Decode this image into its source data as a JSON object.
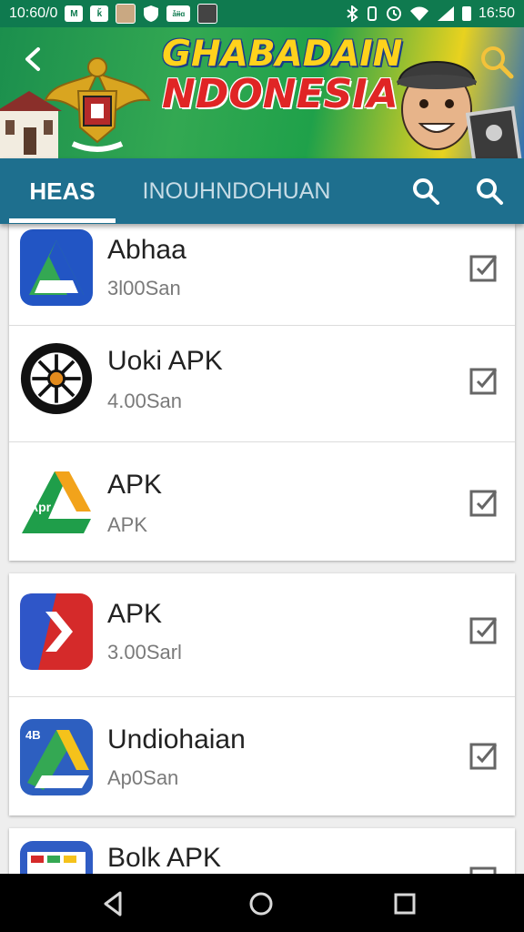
{
  "status_bar": {
    "left_text": "10:60/0",
    "left_badges": [
      "M",
      "ǩ",
      "ǡɨɨɑ"
    ],
    "time": "16:50"
  },
  "banner": {
    "title_line1": "GHABADAIN",
    "title_line2": "NDONESIA"
  },
  "tabs": [
    {
      "label": "HEAS",
      "active": true
    },
    {
      "label": "INOUHNDOHUAN",
      "active": false
    }
  ],
  "apps": [
    {
      "name": "Abhaa",
      "size": "3l00San",
      "icon": "blue-green-triangle-icon"
    },
    {
      "name": "Uoki APK",
      "size": "4.00San",
      "icon": "black-wheel-icon"
    },
    {
      "name": "APK",
      "size": "APK",
      "icon": "green-orange-triangle-icon"
    },
    {
      "name": "APK",
      "size": "3.00Sarl",
      "icon": "red-blue-arrow-icon"
    },
    {
      "name": "Undiohaian",
      "size": "Ap0San",
      "icon": "drive-triangle-icon"
    },
    {
      "name": "Bolk APK",
      "size": "",
      "icon": "card-stack-icon"
    }
  ],
  "colors": {
    "status_bar": "#0f7a4f",
    "tab_bar": "#1e6f8e",
    "nav_bar": "#000000",
    "card": "#ffffff",
    "background": "#eeeeee"
  }
}
